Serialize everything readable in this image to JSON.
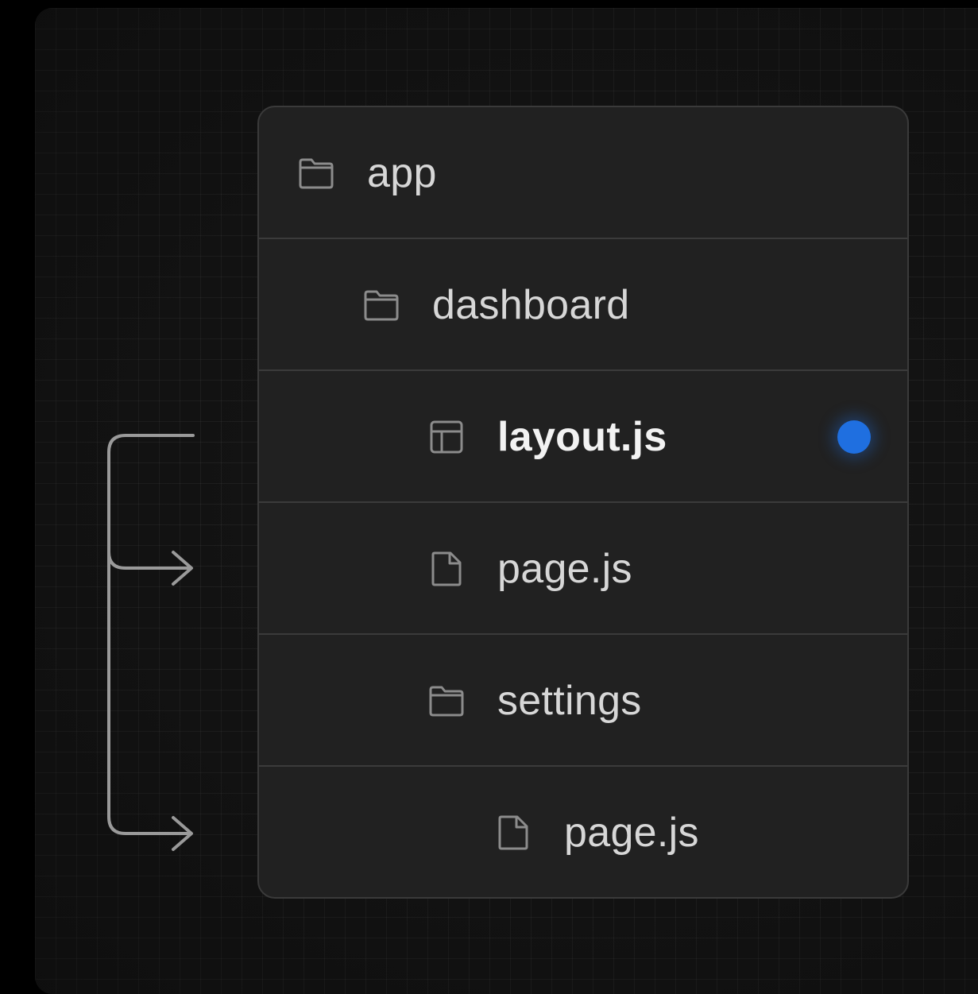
{
  "colors": {
    "background": "#000000",
    "canvas": "#141414",
    "card": "#212121",
    "text": "#d7d7d7",
    "text_highlight": "#f2f2f2",
    "accent_dot": "#1f6fe0",
    "connector": "#9a9a9a"
  },
  "tree": [
    {
      "label": "app",
      "icon": "folder-icon",
      "depth": 0,
      "highlight": false
    },
    {
      "label": "dashboard",
      "icon": "folder-icon",
      "depth": 1,
      "highlight": false
    },
    {
      "label": "layout.js",
      "icon": "layout-icon",
      "depth": 2,
      "highlight": true,
      "marker": "blue-dot"
    },
    {
      "label": "page.js",
      "icon": "file-icon",
      "depth": 2,
      "highlight": false
    },
    {
      "label": "settings",
      "icon": "folder-icon",
      "depth": 2,
      "highlight": false
    },
    {
      "label": "page.js",
      "icon": "file-icon",
      "depth": 3,
      "highlight": false
    }
  ]
}
